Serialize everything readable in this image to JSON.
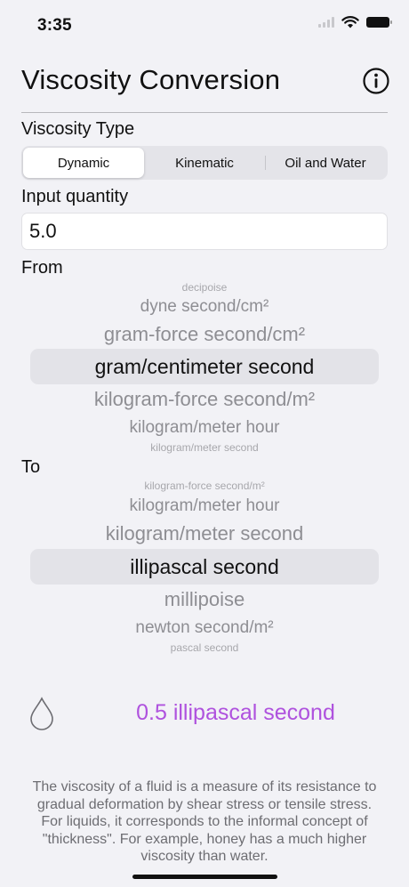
{
  "status": {
    "time": "3:35"
  },
  "header": {
    "title": "Viscosity Conversion",
    "info_icon": "info-circle-icon"
  },
  "viscosity_type": {
    "label": "Viscosity Type",
    "segments": [
      "Dynamic",
      "Kinematic",
      "Oil and Water"
    ],
    "selected": "Dynamic"
  },
  "input": {
    "label": "Input quantity",
    "value": "5.0"
  },
  "from": {
    "label": "From",
    "items": [
      "decipoise",
      "dyne second/cm²",
      "gram-force second/cm²",
      "gram/centimeter second",
      "kilogram-force second/m²",
      "kilogram/meter hour",
      "kilogram/meter second"
    ],
    "selected": "gram/centimeter second"
  },
  "to": {
    "label": "To",
    "items": [
      "kilogram-force second/m²",
      "kilogram/meter hour",
      "kilogram/meter second",
      "illipascal second",
      "millipoise",
      "newton second/m²",
      "pascal second"
    ],
    "selected": "illipascal second"
  },
  "result": {
    "text": "0.5 illipascal second",
    "icon": "drop-icon",
    "color": "#af52de"
  },
  "description": "The viscosity of a fluid is a measure of its resistance to gradual deformation by shear stress or tensile stress. For liquids, it corresponds to the informal concept of \"thickness\". For example, honey has a much higher viscosity than water."
}
